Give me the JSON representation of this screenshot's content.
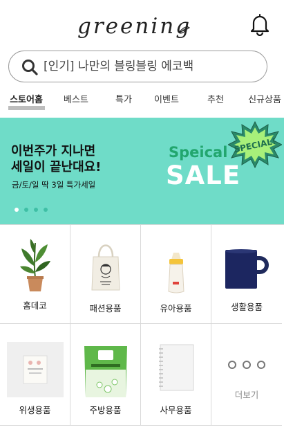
{
  "header": {
    "logo_text": "greening",
    "bell_icon": "bell-icon"
  },
  "search": {
    "placeholder": "[인기] 나만의 블링블링 에코백",
    "icon": "search-icon"
  },
  "tabs": [
    {
      "label": "스토어홈",
      "active": true
    },
    {
      "label": "베스트",
      "active": false
    },
    {
      "label": "특가",
      "active": false
    },
    {
      "label": "이벤트",
      "active": false
    },
    {
      "label": "추천",
      "active": false
    },
    {
      "label": "신규상품",
      "active": false
    }
  ],
  "banner": {
    "title_line1": "이번주가 지나면",
    "title_line2": "세일이 끝난대요!",
    "subtitle": "금/토/일 딱 3일 특가세일",
    "speical": "Speical",
    "sale": "SALE",
    "badge_text": "SPECIAL!",
    "active_slide": 1,
    "slide_count": 4,
    "background_color": "#6fdcc8",
    "accent_color": "#22a66e"
  },
  "categories": [
    {
      "label": "홈데코",
      "icon": "plant-icon"
    },
    {
      "label": "패션용품",
      "icon": "tote-bag-icon"
    },
    {
      "label": "유아용품",
      "icon": "baby-bottle-icon"
    },
    {
      "label": "생활용품",
      "icon": "mug-icon"
    },
    {
      "label": "위생용품",
      "icon": "soap-box-icon"
    },
    {
      "label": "주방용품",
      "icon": "laundry-bag-icon"
    },
    {
      "label": "사무용품",
      "icon": "notebook-icon"
    },
    {
      "label": "더보기",
      "icon": "more-dots-icon"
    }
  ]
}
